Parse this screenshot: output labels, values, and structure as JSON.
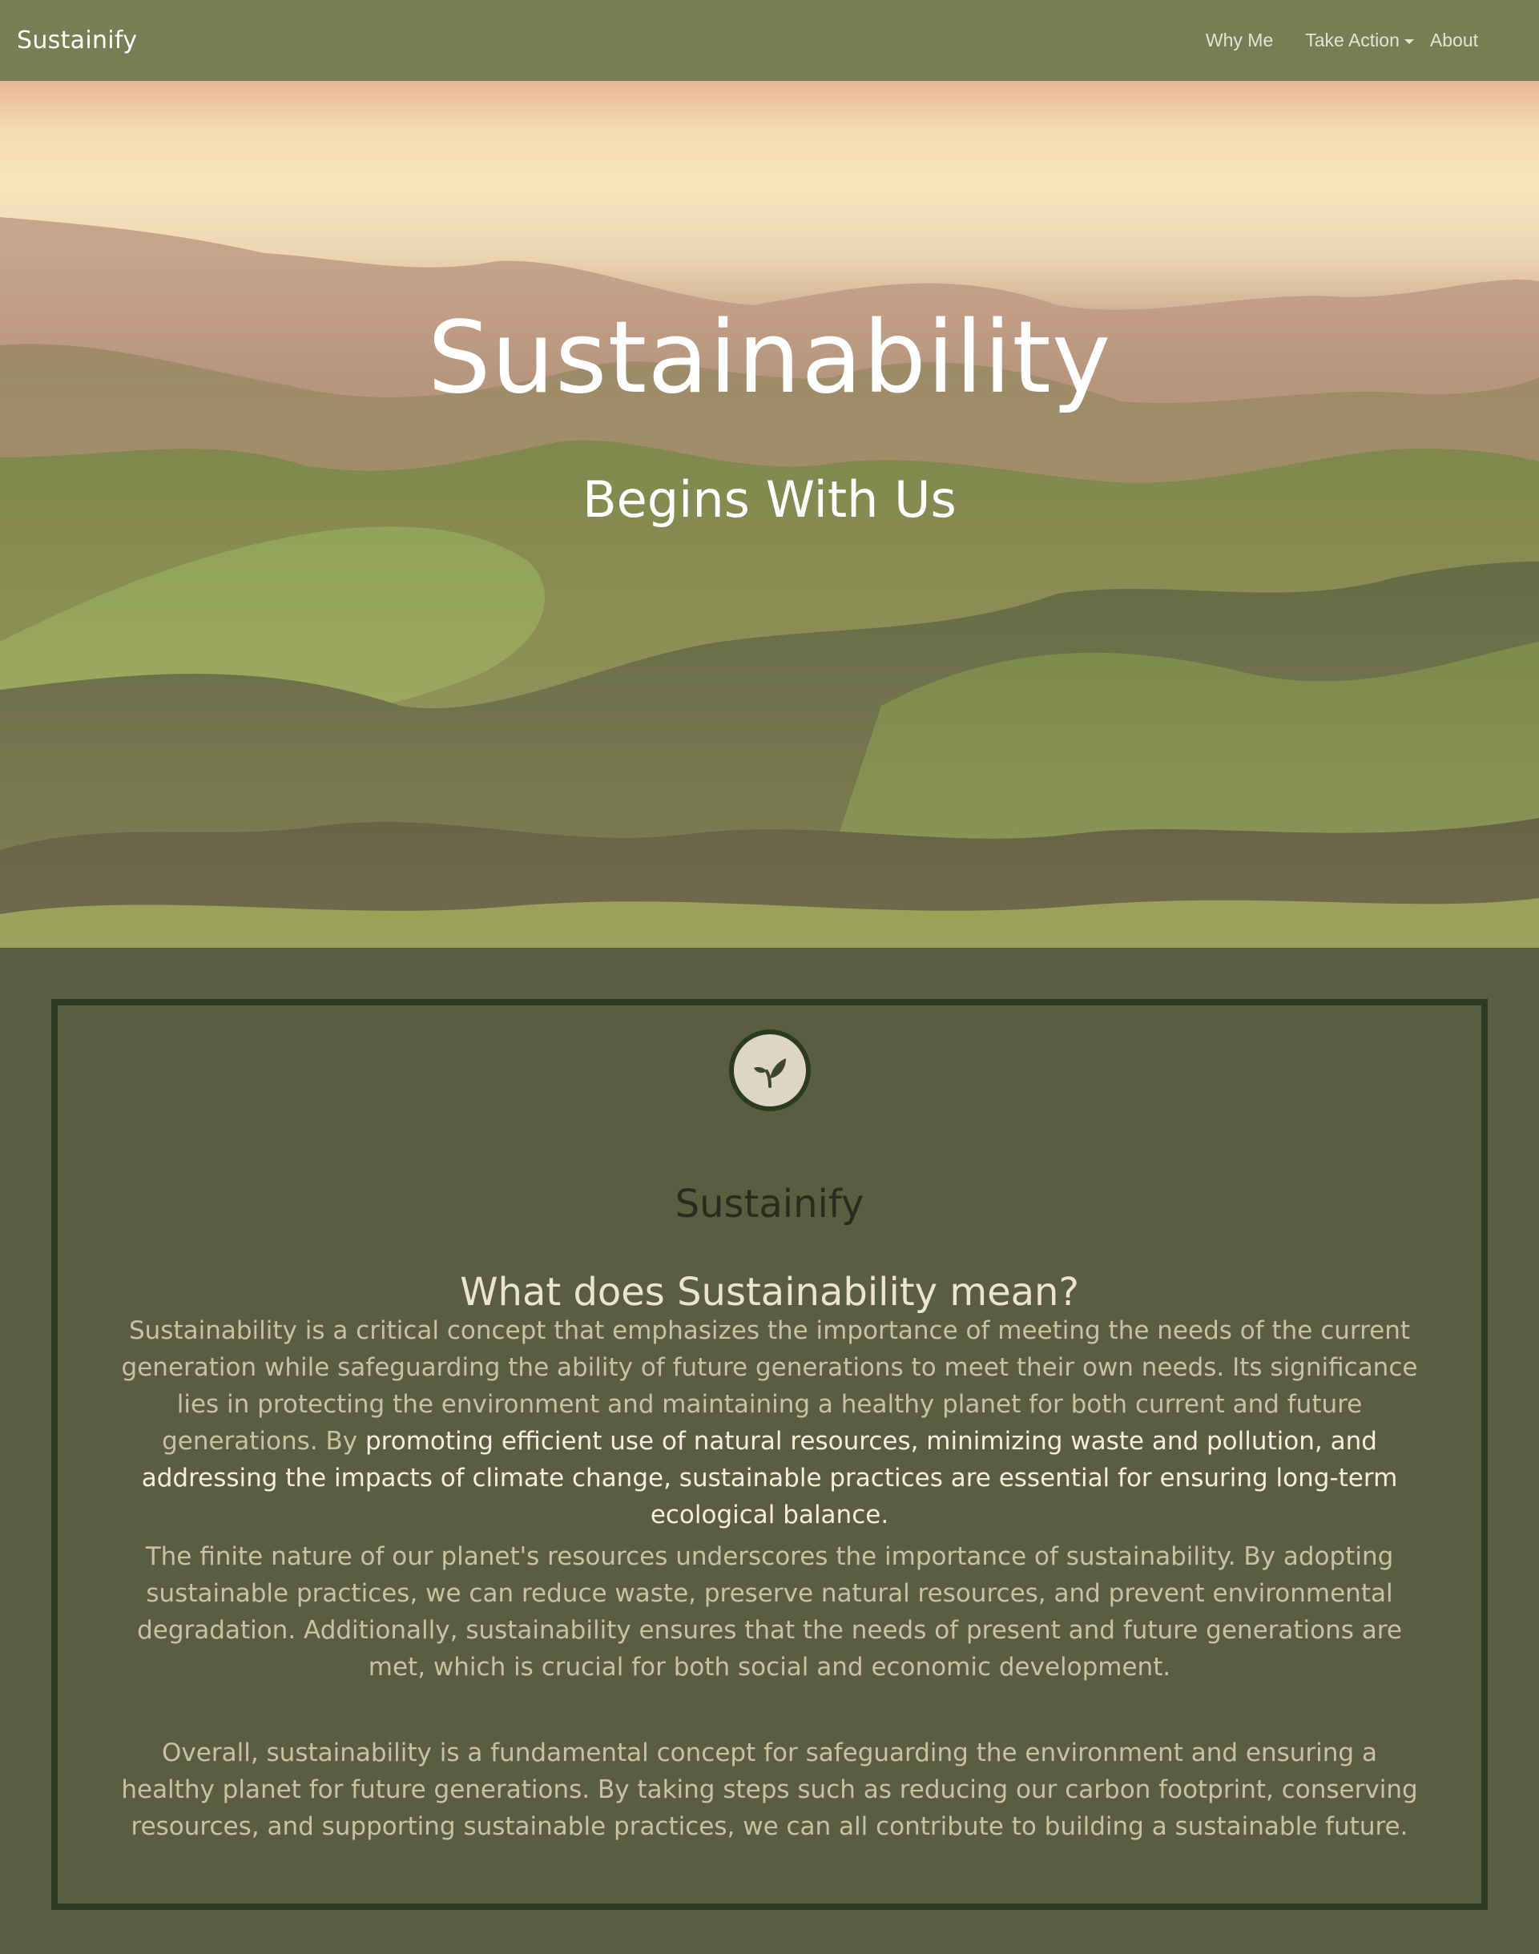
{
  "navbar": {
    "brand": "Sustainify",
    "links": {
      "why_me": "Why Me",
      "take_action": "Take Action",
      "about": "About"
    }
  },
  "hero": {
    "title": "Sustainability",
    "subtitle": "Begins With Us"
  },
  "card": {
    "logo_icon": "sprout-icon",
    "brand": "Sustainify",
    "heading": "What does Sustainability mean?",
    "paragraph1": {
      "dim": "Sustainability is a critical concept that emphasizes the importance of meeting the needs of the current generation while safeguarding the ability of future generations to meet their own needs. Its significance lies in protecting the environment and maintaining a healthy planet for both current and future generations. By",
      "bright": "promoting efficient use of natural resources, minimizing waste and pollution, and addressing the impacts of climate change, sustainable practices are essential for ensuring long-term ecological balance."
    },
    "paragraph2": "The finite nature of our planet's resources underscores the importance of sustainability. By adopting sustainable practices, we can reduce waste, preserve natural resources, and prevent environmental degradation. Additionally, sustainability ensures that the needs of present and future generations are met, which is crucial for both social and economic development.",
    "paragraph3": "Overall, sustainability is a fundamental concept for safeguarding the environment and ensuring a healthy planet for future generations. By taking steps such as reducing our carbon footprint, conserving resources, and supporting sustainable practices, we can all contribute to building a sustainable future."
  },
  "colors": {
    "navbar_bg": "#787d54",
    "page_bg": "#5a5d40",
    "card_border": "#2b3b1f",
    "heading_text": "#ece4cf",
    "body_text": "#c7c2a6"
  }
}
